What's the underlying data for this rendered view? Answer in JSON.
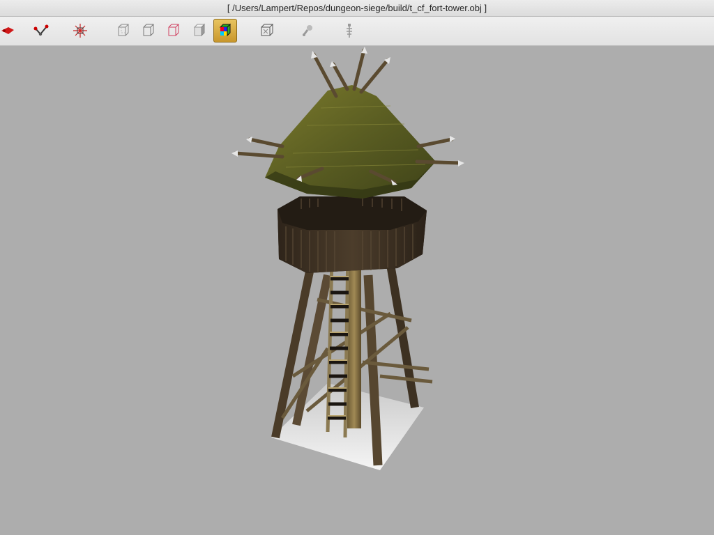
{
  "window": {
    "title": "[ /Users/Lampert/Repos/dungeon-siege/build/t_cf_fort-tower.obj ]"
  },
  "toolbar": {
    "tools": [
      {
        "icon": "move-light-icon"
      },
      {
        "icon": "vertex-edit-icon"
      },
      {
        "icon": "vertex-normals-icon"
      },
      {
        "icon": "wireframe-icon"
      },
      {
        "icon": "hidden-line-icon"
      },
      {
        "icon": "wireframe-colored-icon"
      },
      {
        "icon": "solid-shading-icon"
      },
      {
        "icon": "texture-shading-icon",
        "active": true
      },
      {
        "icon": "bounding-box-icon"
      },
      {
        "icon": "lighting-icon"
      },
      {
        "icon": "skeleton-icon"
      }
    ]
  },
  "viewport": {
    "background": "#adadad",
    "model": "fort tower"
  }
}
